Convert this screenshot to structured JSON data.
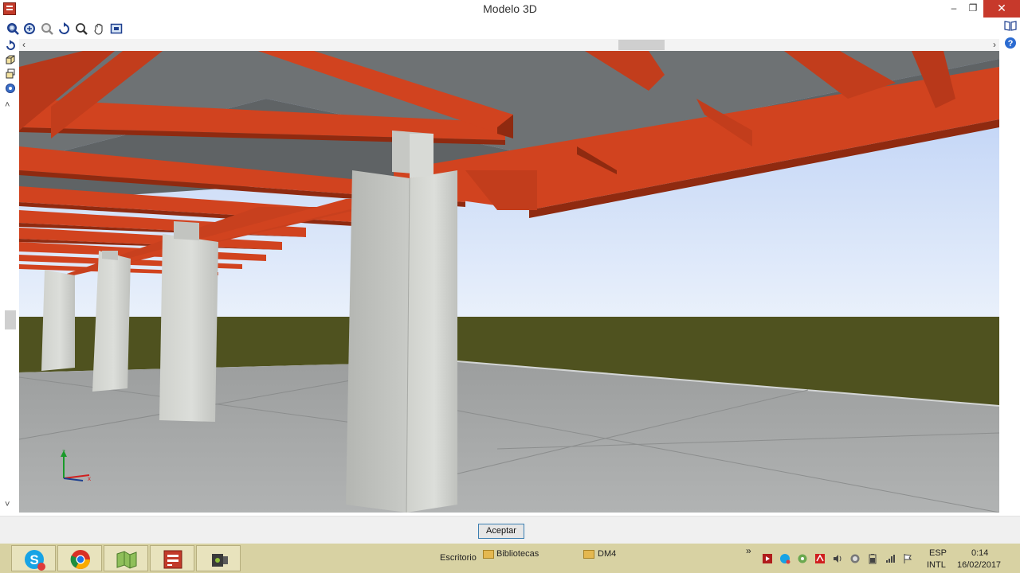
{
  "window": {
    "title": "Modelo 3D",
    "minimize_glyph": "–",
    "maximize_glyph": "❐",
    "close_glyph": "✕"
  },
  "toolbar": {
    "tools": [
      "zoom-window-icon",
      "zoom-extents-icon",
      "zoom-previous-icon",
      "rotate-view-icon",
      "zoom-icon",
      "pan-hand-icon",
      "fit-view-icon"
    ]
  },
  "left_tools": [
    "orbit-icon",
    "view-cube-icon",
    "layers-icon",
    "render-settings-icon"
  ],
  "right_tools": [
    "book-icon",
    "help-icon"
  ],
  "scroll": {
    "left_arrow": "‹",
    "right_arrow": "›",
    "up_arrow": "˄",
    "down_arrow": "˅"
  },
  "axes": {
    "z_label": "z",
    "x_label": "x"
  },
  "colors": {
    "steel_beam": "#d1431f",
    "steel_beam_dark": "#8f2a10",
    "slab": "#6e7274",
    "sky_top": "#b7cdf5",
    "sky_bottom": "#eaf1fb",
    "ground_far": "#4f521f",
    "floor": "#a7a9a9",
    "column": "#d4d6d2",
    "accent_blue": "#3c7fb1",
    "close_red": "#c7392b"
  },
  "footer": {
    "accept_label": "Aceptar"
  },
  "taskbar": {
    "apps": [
      "skype-icon",
      "chrome-icon",
      "map-app-icon",
      "cype-app-icon",
      "video-recorder-icon"
    ],
    "desktop_label": "Escritorio",
    "libraries_label": "Bibliotecas",
    "folder_label": "DM4",
    "chevron": "»",
    "language": "ESP",
    "keyboard": "INTL",
    "time": "0:14",
    "date": "16/02/2017",
    "tray": [
      "red-app-icon",
      "skype-tray-icon",
      "network-tray-icon",
      "antivirus-icon",
      "speaker-icon",
      "record-icon",
      "battery-icon",
      "signal-icon",
      "flag-icon"
    ]
  }
}
